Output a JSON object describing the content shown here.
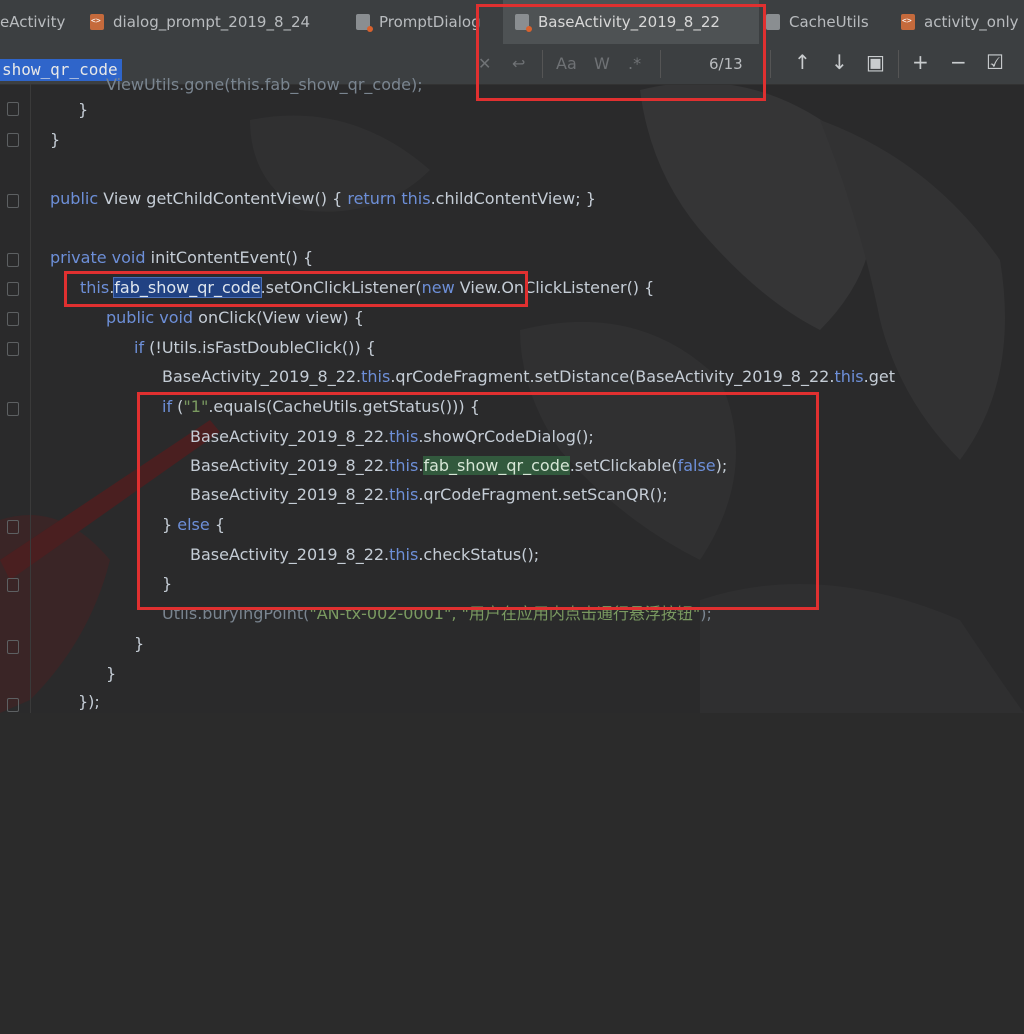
{
  "tabs": [
    {
      "label": "eActivity",
      "icon": "java-file-icon",
      "active": false
    },
    {
      "label": "dialog_prompt_2019_8_24",
      "icon": "xml-file-icon",
      "active": false
    },
    {
      "label": "PromptDialog",
      "icon": "java-file-icon",
      "active": false
    },
    {
      "label": "BaseActivity_2019_8_22",
      "icon": "java-file-icon",
      "active": true
    },
    {
      "label": "CacheUtils",
      "icon": "class-file-icon",
      "active": false
    },
    {
      "label": "activity_only",
      "icon": "xml-file-icon",
      "active": false
    }
  ],
  "find": {
    "query": "show_qr_code",
    "match_count": "6/13",
    "opt_case": "Aa",
    "opt_words": "W",
    "opt_regex": ".*"
  },
  "code": {
    "l0": "ViewUtils.gone(this.fab_show_qr_code);",
    "l1": "}",
    "l2": "}",
    "l3_kw1": "public",
    "l3_a": " View getChildContentView() { ",
    "l3_kw2": "return",
    "l3_kw3": " this",
    "l3_b": ".childContentView; }",
    "l4_kw1": "private",
    "l4_kw2": " void",
    "l4_a": " initContentEvent() {",
    "l5_kw1": "this",
    "l5_dot": ".",
    "l5_sel": "fab_show_qr_code",
    "l5_a": ".setOnClickListener(",
    "l5_kw2": "new",
    "l5_b": " View.OnClickListener() {",
    "l6_kw1": "public",
    "l6_kw2": " void",
    "l6_a": " onClick(View view) {",
    "l7_kw": "if",
    "l7_a": " (!Utils.isFastDoubleClick()) {",
    "l8_a": "BaseActivity_2019_8_22.",
    "l8_kw": "this",
    "l8_b": ".qrCodeFragment.setDistance(BaseActivity_2019_8_22.",
    "l8_kw2": "this",
    "l8_c": ".get",
    "l9_kw": "if",
    "l9_a": " (",
    "l9_str": "\"1\"",
    "l9_b": ".equals(CacheUtils.getStatus())) {",
    "l10_a": "BaseActivity_2019_8_22.",
    "l10_kw": "this",
    "l10_b": ".showQrCodeDialog();",
    "l11_a": "BaseActivity_2019_8_22.",
    "l11_kw": "this",
    "l11_dot": ".",
    "l11_match": "fab_show_qr_code",
    "l11_b": ".setClickable(",
    "l11_kw2": "false",
    "l11_c": ");",
    "l12_a": "BaseActivity_2019_8_22.",
    "l12_kw": "this",
    "l12_b": ".qrCodeFragment.setScanQR();",
    "l13_a": "} ",
    "l13_kw": "else",
    "l13_b": " {",
    "l14_a": "BaseActivity_2019_8_22.",
    "l14_kw": "this",
    "l14_b": ".checkStatus();",
    "l15": "}",
    "l16_a": "Utils.buryingPoint(",
    "l16_str": "\"AN-tx-002-0001\", \"用户在应用内点击通行悬浮按钮\"",
    "l16_b": ");",
    "l17": "}",
    "l18": "}",
    "l19": "});"
  },
  "colors": {
    "keyword": "#6d8fd8",
    "string": "#7a9a60",
    "annotation": "#e03030",
    "selection": "#214283",
    "match": "#32593d"
  }
}
